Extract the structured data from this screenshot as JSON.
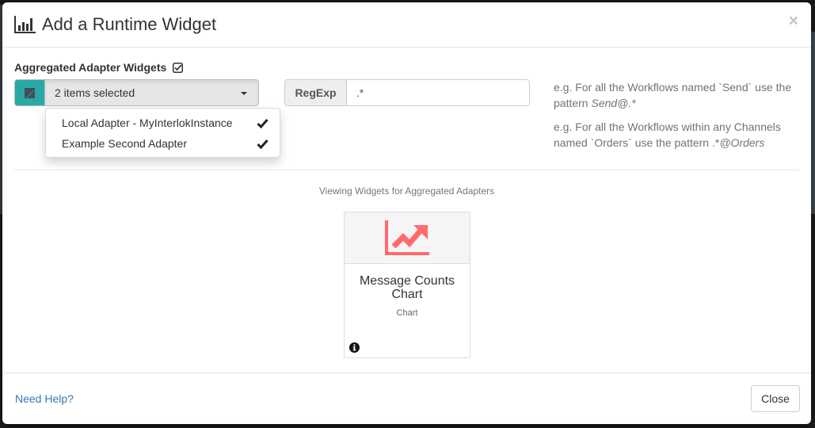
{
  "modal": {
    "title": "Add a Runtime Widget",
    "title_icon": "bar-chart-icon",
    "close_symbol": "×"
  },
  "aggregated": {
    "label": "Aggregated Adapter Widgets",
    "checked_icon": "check-square-icon",
    "checked": true
  },
  "adapter_select": {
    "addon_icon": "adapter-icon",
    "addon_color": "#2aa8a8",
    "selected_text": "2 items selected",
    "options": [
      {
        "label": "Local Adapter - MyInterlokInstance",
        "selected": true
      },
      {
        "label": "Example Second Adapter",
        "selected": true
      }
    ]
  },
  "regexp": {
    "label": "RegExp",
    "value": ".*"
  },
  "help": {
    "line1_prefix": "e.g. For all the Workflows named `Send` use the pattern ",
    "line1_pattern": "Send@.*",
    "line2_prefix": "e.g. For all the Workflows within any Channels named `Orders` use the pattern ",
    "line2_pattern_plain": ".*",
    "line2_pattern_italic": "@Orders"
  },
  "widgets": {
    "viewing_label": "Viewing Widgets for Aggregated Adapters",
    "items": [
      {
        "title": "Message Counts Chart",
        "type": "Chart",
        "icon": "line-chart-icon",
        "icon_color": "#ff6b6b",
        "info_icon": "info-circle-icon"
      }
    ]
  },
  "footer": {
    "help_link": "Need Help?",
    "close_label": "Close"
  }
}
